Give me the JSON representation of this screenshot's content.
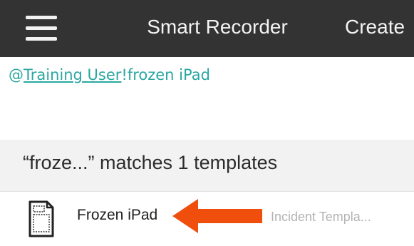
{
  "header": {
    "menu_icon": "hamburger-menu-icon",
    "title": "Smart Recorder",
    "create_label": "Create",
    "background_color": "#333333",
    "text_color": "#f4f4f4"
  },
  "message": {
    "at_sign": "@",
    "mention": "Training User",
    "bang_text": "!frozen iPad",
    "color": "#2aa7a1"
  },
  "matches": {
    "summary": "“froze...” matches 1 templates"
  },
  "results": [
    {
      "icon": "document-icon",
      "name": "Frozen iPad",
      "type": "Incident Templa..."
    }
  ],
  "annotation": {
    "icon": "arrow-left-icon",
    "color": "#f04e0c"
  }
}
